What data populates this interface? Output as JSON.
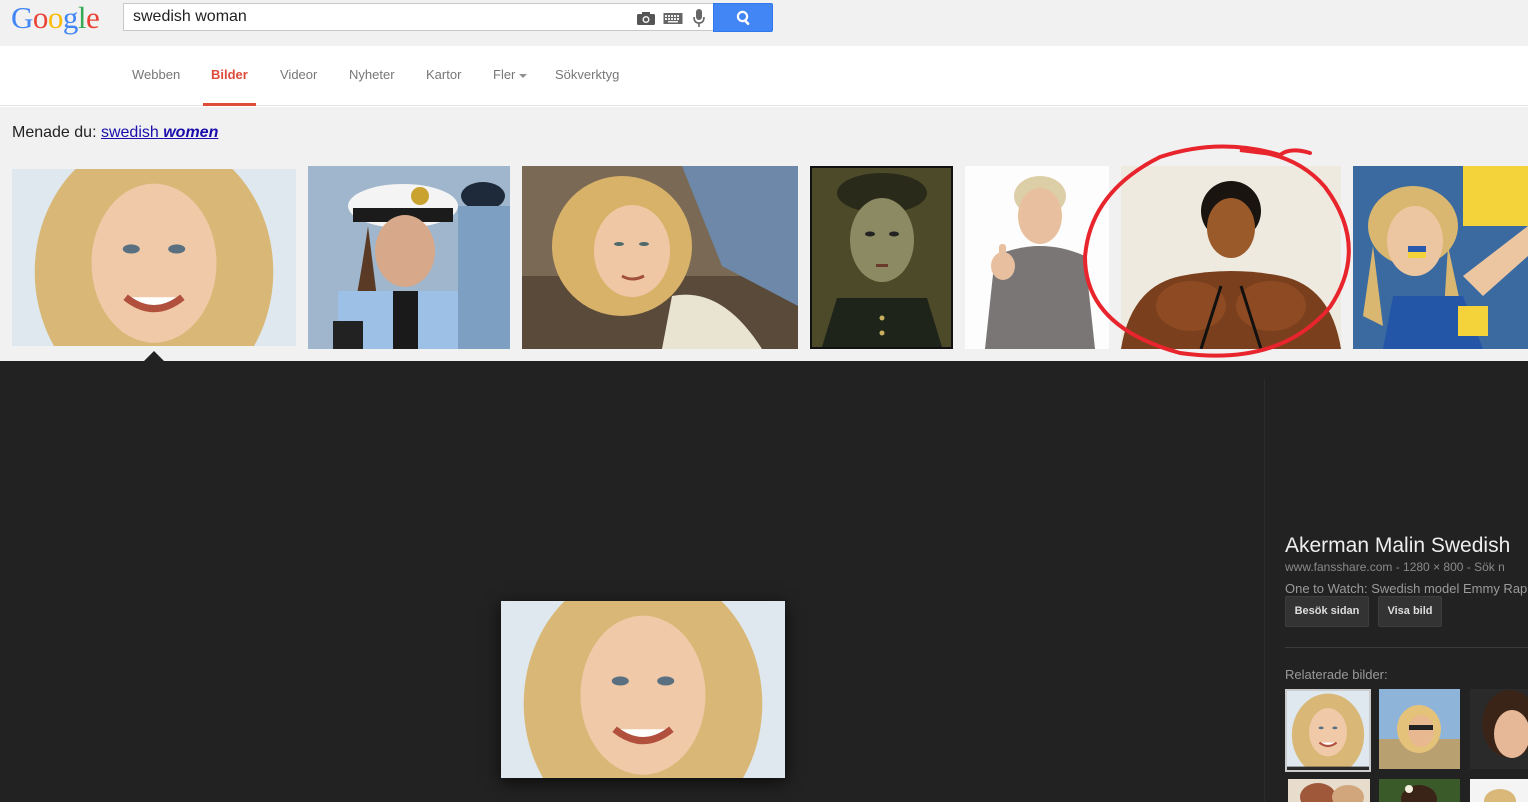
{
  "logo": {
    "letters": [
      "G",
      "o",
      "o",
      "g",
      "l",
      "e"
    ],
    "colors": [
      "#4285f4",
      "#ea4335",
      "#fbbc05",
      "#4285f4",
      "#34a853",
      "#ea4335"
    ]
  },
  "search": {
    "query": "swedish woman",
    "icons": [
      "camera-icon",
      "keyboard-icon",
      "microphone-icon",
      "search-icon"
    ]
  },
  "nav": {
    "tabs": [
      {
        "label": "Webben",
        "active": false
      },
      {
        "label": "Bilder",
        "active": true
      },
      {
        "label": "Videor",
        "active": false
      },
      {
        "label": "Nyheter",
        "active": false
      },
      {
        "label": "Kartor",
        "active": false
      },
      {
        "label": "Fler",
        "active": false,
        "dropdown": true
      },
      {
        "label": "Sökverktyg",
        "active": false
      }
    ]
  },
  "suggestion": {
    "prefix": "Menade du:",
    "word1": "swedish",
    "word2": "women"
  },
  "annotation_color": "#e8252d",
  "detail": {
    "title": "Akerman Malin Swedish",
    "meta": "www.fansshare.com - 1280 × 800 - Sök n",
    "desc": "One to Watch: Swedish model Emmy Rap",
    "visit_button": "Besök sidan",
    "view_button": "Visa bild",
    "related_label": "Relaterade bilder:"
  },
  "colors": {
    "accent": "#dd4b39",
    "search_blue": "#4285f4",
    "link": "#1a0dab",
    "panel_bg": "#222222"
  }
}
